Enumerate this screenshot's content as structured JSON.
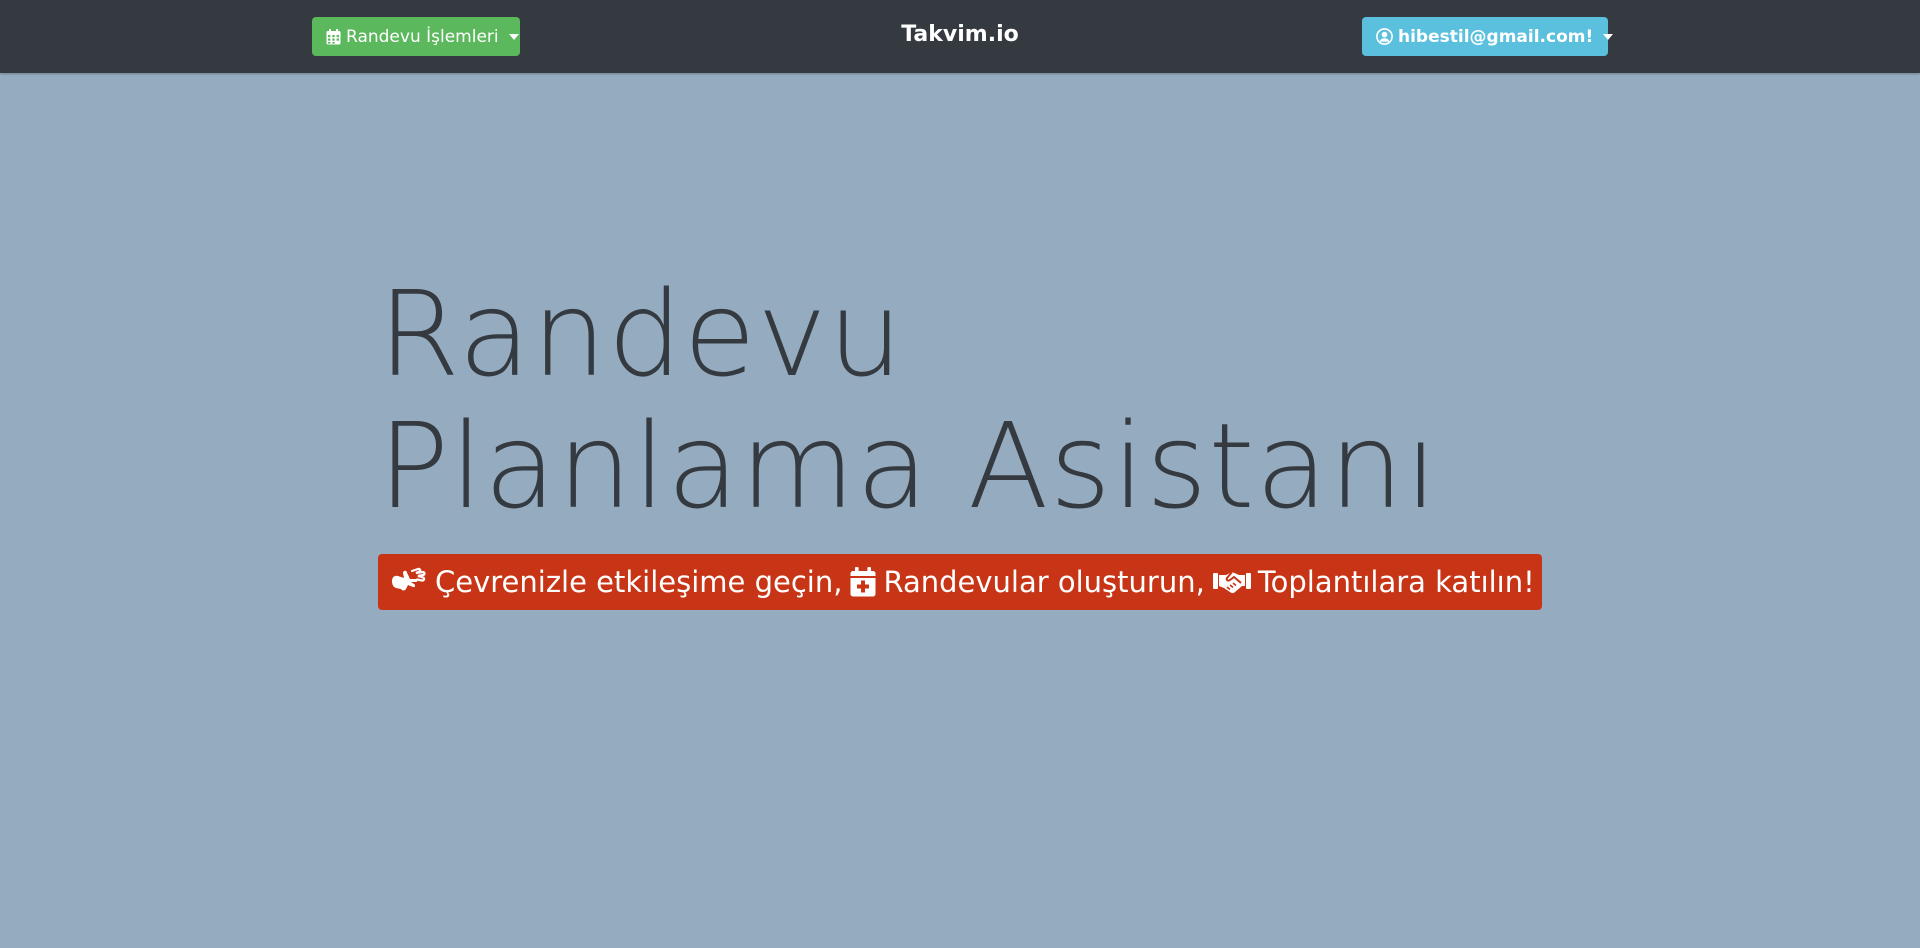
{
  "navbar": {
    "appointments_button": {
      "label": "Randevu İşlemleri",
      "icon": "calendar-icon",
      "color": "#5cb85c"
    },
    "brand": "Takvim.io",
    "user_button": {
      "label": "hibestil@gmail.com!",
      "icon": "user-circle-icon",
      "color": "#5bc0de"
    }
  },
  "hero": {
    "title_line1": "Randevu",
    "title_line2": "Planlama Asistanı"
  },
  "banner": {
    "color": "#c73516",
    "items": [
      {
        "icon": "sign-language-icon",
        "text": "Çevrenizle etkileşime geçin,"
      },
      {
        "icon": "calendar-plus-icon",
        "text": "Randevular oluşturun,"
      },
      {
        "icon": "handshake-icon",
        "text": "Toplantılara katılın!"
      }
    ]
  }
}
